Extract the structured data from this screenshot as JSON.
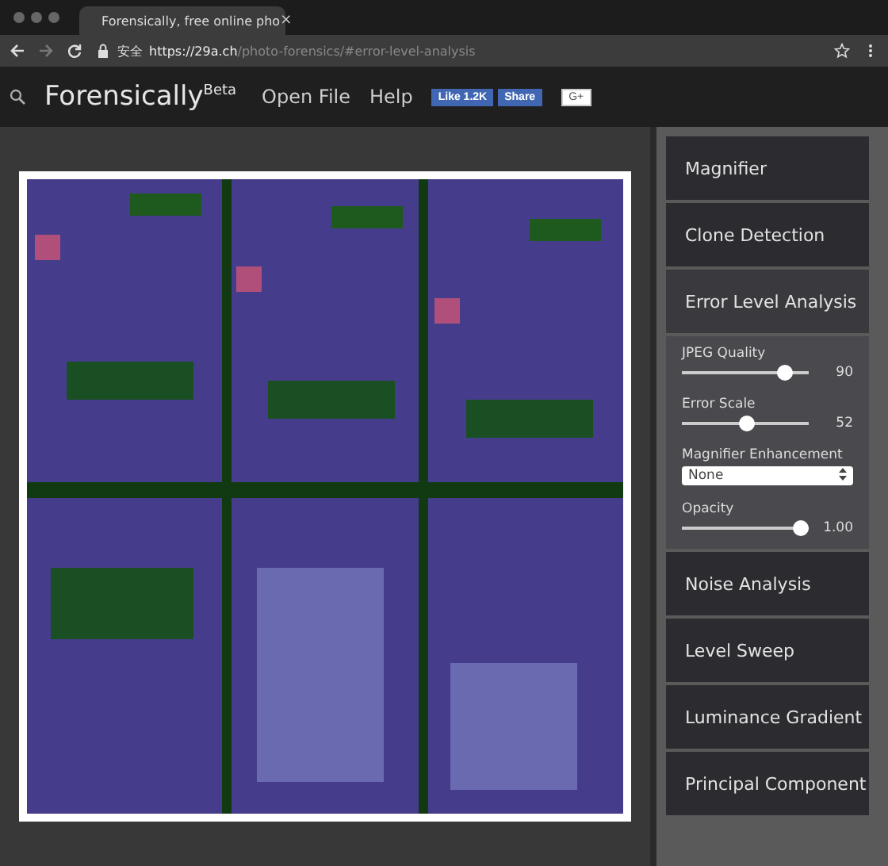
{
  "browser": {
    "tab_title": "Forensically, free online pho",
    "tab_close": "×",
    "security_label": "安全",
    "url_host": "https://29a.ch",
    "url_path": "/photo-forensics/#error-level-analysis"
  },
  "header": {
    "logo": "Forensically",
    "logo_sup": "Beta",
    "nav": [
      "Open File",
      "Help"
    ],
    "like": "Like 1.2K",
    "share": "Share",
    "gplus": "G+"
  },
  "sidebar": [
    {
      "kind": "section",
      "label": "Magnifier",
      "expanded": false
    },
    {
      "kind": "section",
      "label": "Clone Detection",
      "expanded": false
    },
    {
      "kind": "section",
      "label": "Error Level Analysis",
      "expanded": true,
      "controls": [
        {
          "kind": "slider",
          "label": "JPEG Quality",
          "level": 0.86,
          "reading": "90"
        },
        {
          "kind": "slider",
          "label": "Error Scale",
          "level": 0.52,
          "reading": "52"
        },
        {
          "kind": "select",
          "label": "Magnifier Enhancement",
          "value": "None"
        },
        {
          "kind": "slider",
          "label": "Opacity",
          "level": 1,
          "reading": "1.00"
        }
      ]
    },
    {
      "kind": "section",
      "label": "Noise Analysis",
      "expanded": false
    },
    {
      "kind": "section",
      "label": "Level Sweep",
      "expanded": false
    },
    {
      "kind": "section",
      "label": "Luminance Gradient",
      "expanded": false
    },
    {
      "kind": "section",
      "label": "Principal Component",
      "expanded": false
    }
  ]
}
